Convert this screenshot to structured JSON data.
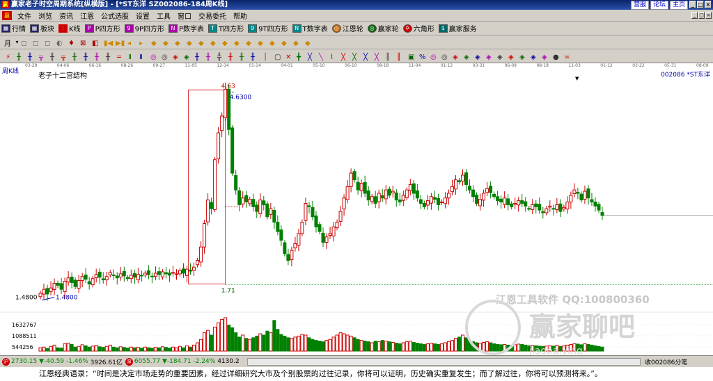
{
  "title_bar": {
    "app_logo": "赢",
    "title": "赢家老子时空周期系统[纵横版] - [*ST东洋  SZ002086-184周K线]",
    "links": [
      "营服",
      "论坛",
      "主页"
    ]
  },
  "menu": {
    "logo": "赢",
    "items": [
      "文件",
      "浏览",
      "资讯",
      "江恩",
      "公式选股",
      "设置",
      "工具",
      "窗口",
      "交易委托",
      "帮助"
    ]
  },
  "toolbar1": {
    "items": [
      "行情",
      "板块",
      "K线",
      "P四方形",
      "9P四方形",
      "P数字表",
      "T四方形",
      "9T四方形",
      "T数字表",
      "江恩轮",
      "赢家轮",
      "六角形",
      "赢家服务"
    ]
  },
  "toolbar2": {
    "period": "月"
  },
  "chart": {
    "left_label": "周K线",
    "subtitle": "老子十二宫结构",
    "stock": "002086 *ST东洋",
    "watermark1": "江恩工具软件  QQ:100800360",
    "watermark2": "赢家聊吧",
    "watermark_url": "jiaoba.ying"
  },
  "chart_data": {
    "type": "candlestick",
    "time_axis": [
      "03-29",
      "04-06",
      "06-16",
      "08-26",
      "09-27",
      "11-05",
      "12-14",
      "01-14",
      "04-01",
      "05-10",
      "06-10",
      "08-18",
      "11-04",
      "01-12",
      "03-31",
      "06-09",
      "08-18",
      "11-03",
      "01-12",
      "03-22",
      "05-31",
      "08-09"
    ],
    "price_labels": {
      "high": "4.63",
      "high_sub": "4.6300",
      "box_low": "1.71",
      "low": "1.4800",
      "low_sub": "1.4800"
    },
    "volume_ticks": [
      "1632767",
      "1088511",
      "544256"
    ],
    "closes": [
      1.56,
      1.62,
      1.55,
      1.64,
      1.71,
      1.68,
      1.62,
      1.74,
      1.79,
      1.72,
      1.66,
      1.75,
      1.81,
      1.77,
      1.7,
      1.78,
      1.84,
      1.8,
      1.76,
      1.81,
      1.87,
      1.83,
      1.79,
      1.85,
      1.82,
      1.78,
      1.83,
      1.8,
      1.84,
      1.82,
      1.86,
      1.84,
      1.81,
      1.86,
      1.84,
      1.88,
      1.85,
      1.83,
      1.87,
      1.85,
      1.9,
      1.86,
      1.92,
      1.89,
      1.95,
      2.05,
      2.25,
      2.6,
      2.95,
      2.82,
      3.55,
      3.95,
      4.2,
      4.6,
      4.0,
      3.35,
      3.1,
      2.88,
      2.98,
      2.92,
      2.96,
      2.85,
      2.78,
      2.95,
      2.88,
      2.7,
      2.82,
      2.62,
      2.48,
      2.35,
      2.15,
      2.05,
      2.2,
      2.3,
      2.45,
      2.62,
      2.9,
      2.85,
      2.7,
      2.55,
      2.48,
      2.32,
      2.4,
      2.45,
      2.55,
      2.62,
      2.78,
      2.98,
      3.15,
      3.35,
      3.25,
      3.1,
      3.2,
      3.05,
      2.95,
      3.0,
      2.9,
      3.05,
      2.98,
      3.1,
      3.02,
      3.08,
      2.95,
      2.92,
      3.02,
      3.1,
      3.18,
      3.05,
      2.98,
      2.9,
      2.85,
      2.94,
      3.0,
      2.96,
      2.88,
      2.92,
      2.98,
      3.05,
      3.15,
      3.25,
      3.22,
      3.32,
      3.18,
      3.1,
      3.0,
      2.9,
      2.96,
      3.05,
      3.12,
      3.06,
      3.0,
      2.94,
      2.92,
      2.98,
      2.88,
      2.85,
      2.9,
      2.94,
      2.9,
      2.86,
      2.82,
      2.88,
      2.85,
      2.8,
      2.76,
      2.82,
      2.86,
      2.82,
      2.88,
      2.78,
      2.84,
      2.92,
      3.02,
      3.1,
      3.05,
      2.95,
      3.08,
      2.98,
      2.92,
      2.86,
      2.8,
      2.72
    ],
    "volumes": [
      0.1,
      0.12,
      0.08,
      0.14,
      0.18,
      0.1,
      0.09,
      0.22,
      0.24,
      0.2,
      0.12,
      0.14,
      0.19,
      0.16,
      0.12,
      0.15,
      0.17,
      0.13,
      0.11,
      0.14,
      0.18,
      0.12,
      0.1,
      0.13,
      0.11,
      0.09,
      0.12,
      0.1,
      0.11,
      0.09,
      0.12,
      0.1,
      0.09,
      0.11,
      0.1,
      0.13,
      0.11,
      0.09,
      0.12,
      0.1,
      0.14,
      0.1,
      0.16,
      0.12,
      0.18,
      0.25,
      0.35,
      0.55,
      0.62,
      0.48,
      0.72,
      0.85,
      0.95,
      1.0,
      0.78,
      0.7,
      0.55,
      0.42,
      0.48,
      0.38,
      0.35,
      0.4,
      0.45,
      0.52,
      0.48,
      0.6,
      0.55,
      0.92,
      0.65,
      0.5,
      0.45,
      0.4,
      0.38,
      0.42,
      0.45,
      0.5,
      0.48,
      0.4,
      0.35,
      0.32,
      0.3,
      0.28,
      0.32,
      0.35,
      0.42,
      0.48,
      0.55,
      0.52,
      0.48,
      0.45,
      0.4,
      0.35,
      0.32,
      0.3,
      0.28,
      0.25,
      0.3,
      0.28,
      0.32,
      0.3,
      0.28,
      0.26,
      0.24,
      0.22,
      0.25,
      0.28,
      0.3,
      0.26,
      0.24,
      0.22,
      0.2,
      0.22,
      0.24,
      0.22,
      0.2,
      0.22,
      0.25,
      0.28,
      0.32,
      0.38,
      0.42,
      0.48,
      0.4,
      0.32,
      0.28,
      0.25,
      0.24,
      0.26,
      0.28,
      0.25,
      0.22,
      0.2,
      0.19,
      0.2,
      0.18,
      0.17,
      0.19,
      0.21,
      0.2,
      0.18,
      0.16,
      0.17,
      0.16,
      0.15,
      0.14,
      0.15,
      0.16,
      0.15,
      0.17,
      0.14,
      0.16,
      0.18,
      0.2,
      0.22,
      0.21,
      0.19,
      0.22,
      0.2,
      0.18,
      0.16,
      0.14,
      0.12
    ],
    "up_color": "#cc0000",
    "down_color": "#008000",
    "price_range": [
      1.3,
      4.8
    ]
  },
  "status": {
    "sh_index": "2730.15",
    "sh_change": "▼-40.59",
    "sh_pct": "-1.46%",
    "sh_amount": "3926.61亿",
    "sz_index": "6055.77",
    "sz_change": "▼-184.71",
    "sz_pct": "-2.24%",
    "sz_amount": "4130.2",
    "right_text": "收002086分笔"
  },
  "quote": "江恩经典语录：“时间是决定市场走势的重要因素，经过详细研究大市及个别股票的过往记录，你将可以证明，历史确实重复发生；而了解过往，你将可以预测将来。”。"
}
